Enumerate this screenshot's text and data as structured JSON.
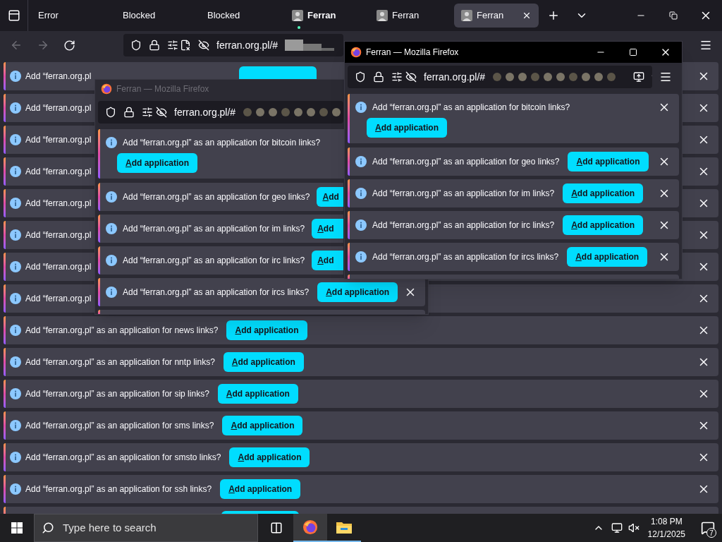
{
  "tabs": [
    {
      "label": "Error",
      "selected": false,
      "attention": false,
      "avatar": false
    },
    {
      "label": "Blocked",
      "selected": false,
      "attention": false,
      "avatar": false
    },
    {
      "label": "Blocked",
      "selected": false,
      "attention": false,
      "avatar": false
    },
    {
      "label": "Ferran",
      "selected": false,
      "attention": true,
      "avatar": true
    },
    {
      "label": "Ferran",
      "selected": false,
      "attention": false,
      "avatar": true
    },
    {
      "label": "Ferran",
      "selected": true,
      "attention": false,
      "avatar": true
    }
  ],
  "address_bar": {
    "url": "ferran.org.pl/#"
  },
  "notifications": [
    {
      "kind": "covered_button",
      "message": "Add “ferran.org.pl"
    },
    {
      "kind": "clipped",
      "message": "Add “ferran.org.pl"
    },
    {
      "kind": "clipped",
      "message": "Add “ferran.org.pl"
    },
    {
      "kind": "clipped",
      "message": "Add “ferran.org.pl"
    },
    {
      "kind": "clipped",
      "message": "Add “ferran.org.pl"
    },
    {
      "kind": "clipped",
      "message": "Add “ferran.org.pl"
    },
    {
      "kind": "clipped",
      "message": "Add “ferran.org.pl"
    },
    {
      "kind": "clipped",
      "message": "Add “ferran.org.pl"
    },
    {
      "kind": "full",
      "message": "Add “ferran.org.pl” as an application for news links?",
      "button": "Add application"
    },
    {
      "kind": "full",
      "message": "Add “ferran.org.pl” as an application for nntp links?",
      "button": "Add application"
    },
    {
      "kind": "full",
      "message": "Add “ferran.org.pl” as an application for sip links?",
      "button": "Add application"
    },
    {
      "kind": "full",
      "message": "Add “ferran.org.pl” as an application for sms links?",
      "button": "Add application"
    },
    {
      "kind": "full",
      "message": "Add “ferran.org.pl” as an application for smsto links?",
      "button": "Add application"
    },
    {
      "kind": "full",
      "message": "Add “ferran.org.pl” as an application for ssh links?",
      "button": "Add application"
    },
    {
      "kind": "cut"
    }
  ],
  "popups": [
    {
      "title": "Ferran — Mozilla Firefox",
      "active": false,
      "url": "ferran.org.pl/#",
      "notifications": [
        {
          "kind": "stacked",
          "close_shown": false,
          "message": "Add “ferran.org.pl” as an application for bitcoin links?",
          "button": "Add application"
        },
        {
          "kind": "inline",
          "close_shown": false,
          "message": "Add “ferran.org.pl” as an application for geo links?",
          "button": "Add"
        },
        {
          "kind": "inline",
          "close_shown": false,
          "message": "Add “ferran.org.pl” as an application for im links?",
          "button": "Add"
        },
        {
          "kind": "inline",
          "close_shown": false,
          "message": "Add “ferran.org.pl” as an application for irc links?",
          "button": "Add"
        },
        {
          "kind": "inline",
          "close_shown": true,
          "message": "Add “ferran.org.pl” as an application for ircs links?",
          "button": "Add application"
        },
        {
          "kind": "cut"
        }
      ]
    },
    {
      "title": "Ferran — Mozilla Firefox",
      "active": true,
      "url": "ferran.org.pl/#",
      "notifications": [
        {
          "kind": "stacked",
          "close_shown": true,
          "message": "Add “ferran.org.pl” as an application for bitcoin links?",
          "button": "Add application"
        },
        {
          "kind": "inline",
          "close_shown": true,
          "message": "Add “ferran.org.pl” as an application for geo links?",
          "button": "Add application"
        },
        {
          "kind": "inline",
          "close_shown": true,
          "message": "Add “ferran.org.pl” as an application for im links?",
          "button": "Add application"
        },
        {
          "kind": "inline",
          "close_shown": true,
          "message": "Add “ferran.org.pl” as an application for irc links?",
          "button": "Add application"
        },
        {
          "kind": "inline",
          "close_shown": true,
          "message": "Add “ferran.org.pl” as an application for ircs links?",
          "button": "Add application"
        },
        {
          "kind": "cut"
        }
      ]
    }
  ],
  "taskbar": {
    "search_placeholder": "Type here to search",
    "apps": [
      {
        "kind": "firefox",
        "selected": true
      },
      {
        "kind": "explorer",
        "selected": false
      }
    ],
    "time": "1:08 PM",
    "date": "12/1/2025",
    "notification_count": "7"
  }
}
